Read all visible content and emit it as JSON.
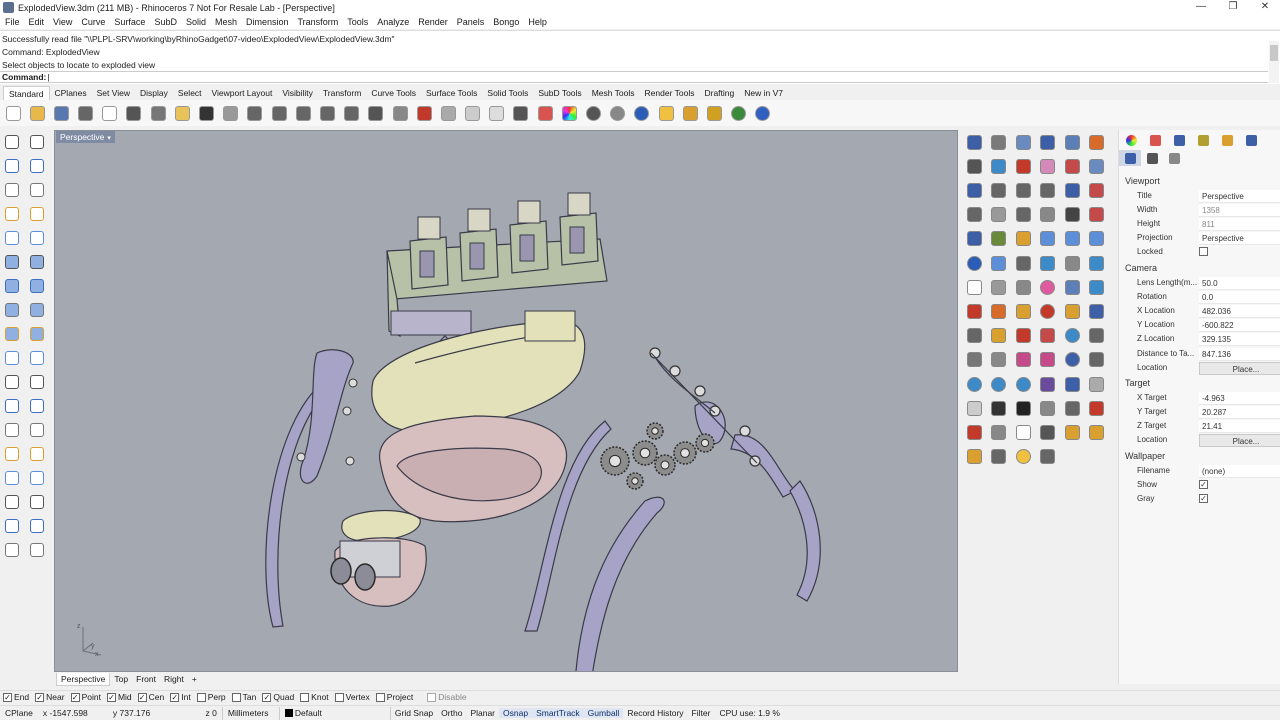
{
  "window": {
    "title": "ExplodedView.3dm (211 MB) - Rhinoceros 7 Not For Resale Lab - [Perspective]",
    "controls": [
      "—",
      "❐",
      "✕"
    ]
  },
  "menu": [
    "File",
    "Edit",
    "View",
    "Curve",
    "Surface",
    "SubD",
    "Solid",
    "Mesh",
    "Dimension",
    "Transform",
    "Tools",
    "Analyze",
    "Render",
    "Panels",
    "Bongo",
    "Help"
  ],
  "command": {
    "history": [
      "Successfully read file \"\\\\PLPL-SRV\\working\\byRhinoGadget\\07-video\\ExplodedView\\ExplodedView.3dm\"",
      "Command: ExplodedView",
      "Select objects to locate to exploded view"
    ],
    "prompt": "Command:"
  },
  "toolbar_tabs": [
    "Standard",
    "CPlanes",
    "Set View",
    "Display",
    "Select",
    "Viewport Layout",
    "Visibility",
    "Transform",
    "Curve Tools",
    "Surface Tools",
    "Solid Tools",
    "SubD Tools",
    "Mesh Tools",
    "Render Tools",
    "Drafting",
    "New in V7"
  ],
  "toolbar_icons": [
    "new-file-icon",
    "open-file-icon",
    "save-icon",
    "print-icon",
    "import-icon",
    "cut-icon",
    "copy-icon",
    "paste-icon",
    "undo-icon",
    "pan-hand-icon",
    "rotate-view-icon",
    "zoom-icon",
    "zoom-window-icon",
    "zoom-extents-icon",
    "zoom-selected-icon",
    "undo-view-icon",
    "grid-icon",
    "car-icon",
    "named-view-icon",
    "cplane-icon",
    "light-bulb-icon",
    "lock-icon",
    "materials-icon",
    "color-wheel-icon",
    "render-sphere-icon",
    "render-sphere-gray-icon",
    "blue-sphere-icon",
    "filter-icon",
    "gear-icon",
    "gears-icon",
    "render-globe-icon",
    "help-icon"
  ],
  "toolbar_icon_colors": [
    "#ffffff",
    "#e8b84a",
    "#5a78b0",
    "#666666",
    "#ffffff",
    "#555555",
    "#777777",
    "#e8c35a",
    "#333333",
    "#999999",
    "#666666",
    "#666666",
    "#666666",
    "#666666",
    "#666666",
    "#555555",
    "#888888",
    "#c0392b",
    "#aaaaaa",
    "#cccccc",
    "#dddddd",
    "#555555",
    "#d9534f",
    "#e05aa0",
    "#555555",
    "#888888",
    "#2b5cb8",
    "#f0c040",
    "#d9a030",
    "#d0a020",
    "#3a8a3a",
    "#3060c0"
  ],
  "viewport": {
    "label": "Perspective",
    "axis": {
      "z": "z",
      "x": "x",
      "y": "y"
    },
    "colors": {
      "bg": "#a4a8b1",
      "purple": "#a7a3c7",
      "green": "#b6c1a8",
      "cream": "#e3e1b9",
      "pink": "#d7bfc0",
      "gear": "#8c8c8c"
    }
  },
  "view_tabs": [
    "Perspective",
    "Top",
    "Front",
    "Right",
    "+"
  ],
  "left_icons": [
    "select-arrow-icon",
    "point-icon",
    "polyline-icon",
    "curve-icon",
    "circle-icon",
    "ellipse-icon",
    "arc-icon",
    "rectangle-icon",
    "polygon-icon",
    "fillet-curve-icon",
    "surface-icon",
    "surface-edit-icon",
    "box-icon",
    "sphere-icon",
    "cylinder-icon",
    "solid-edit-icon",
    "boolean-icon",
    "explode-icon",
    "transform-icon",
    "mirror-icon",
    "group-icon",
    "cluster-icon",
    "split-icon",
    "trim-icon",
    "text-icon",
    "dimension-icon",
    "array-icon",
    "align-icon",
    "mesh-icon",
    "mesh-edit-icon",
    "grid-dots-icon",
    "curve-edit-icon",
    "checkmark-icon",
    "analyze-icon",
    "render-icon",
    "layer-icon"
  ],
  "right_icons": [
    "network-icon",
    "flow-icon",
    "gear-blue-icon",
    "pipe-icon",
    "box-blue-icon",
    "cube-orange-icon",
    "camera-icon",
    "flow-blue-icon",
    "scissors-icon",
    "rhd-icon",
    "frame-icon",
    "box-frame-icon",
    "extrude-icon",
    "sweep-icon",
    "curve-icon",
    "curve-end-icon",
    "loft-icon",
    "arc-red-icon",
    "split-icon",
    "cloud-icon",
    "join-icon",
    "capsule-icon",
    "cube-dark-icon",
    "link-icon",
    "sweep-blue-icon",
    "palm-icon",
    "camera-yellow-icon",
    "cap-blue-icon",
    "cap-blue2-icon",
    "cap-blue3-icon",
    "sphere-blue-icon",
    "blend-icon",
    "chain-icon",
    "flow2-icon",
    "text-123-icon",
    "wave-icon",
    "cube-white-icon",
    "cube-gray-icon",
    "cube-gear-icon",
    "color-ball-icon",
    "box-blue2-icon",
    "cube-front-icon",
    "cube-red-icon",
    "arrows-orange-icon",
    "arrow-target-icon",
    "sphere-color-icon",
    "gear-orange-icon",
    "cube-blue-icon",
    "move-icon",
    "flower-icon",
    "chain-red-icon",
    "grid-red-icon",
    "sphere-grid-icon",
    "transform-icon",
    "pencil-icon",
    "deg-icon",
    "arrow-pink-icon",
    "grid-pink-icon",
    "sphere-half-icon",
    "array-icon",
    "balls-icon",
    "balls2-icon",
    "balls3-icon",
    "grid-purple-icon",
    "cube-blue3-icon",
    "cube-outline-icon",
    "cube-white2-icon",
    "z-icon",
    "z-dark-icon",
    "box-stack-icon",
    "bar-icon",
    "star-icon",
    "target-icon",
    "num-icon",
    "doc-icon",
    "umbrella-icon",
    "pages-icon",
    "folder-icon",
    "file-icon",
    "dot-icon",
    "question-icon",
    "check-line-icon"
  ],
  "right_icon_colors": [
    "#3c5fa8",
    "#7a7a7a",
    "#6a8bc0",
    "#3c5fa8",
    "#5d7fb8",
    "#d96b2a",
    "#555555",
    "#3c8ac8",
    "#c43a2a",
    "#d48ab8",
    "#c44a4a",
    "#6a8bc0",
    "#3c5fa8",
    "#666666",
    "#666666",
    "#666666",
    "#3c5fa8",
    "#c44a4a",
    "#666666",
    "#999999",
    "#666666",
    "#888888",
    "#444444",
    "#c44a4a",
    "#3c5fa8",
    "#6a8a3a",
    "#d9a030",
    "#5d8fd8",
    "#5d8fd8",
    "#5d8fd8",
    "#2b5cb8",
    "#5d8fd8",
    "#666666",
    "#3c8ac8",
    "#888888",
    "#3c8ac8",
    "#ffffff",
    "#999999",
    "#888888",
    "#e05aa0",
    "#5d7fb8",
    "#3c8ac8",
    "#c43a2a",
    "#d96b2a",
    "#d9a030",
    "#c43a2a",
    "#d9a030",
    "#3c5fa8",
    "#666666",
    "#d9a030",
    "#c43a2a",
    "#c44a4a",
    "#3c8ac8",
    "#666666",
    "#777777",
    "#888888",
    "#c44a8a",
    "#c44a8a",
    "#3c5fa8",
    "#666666",
    "#3c8ac8",
    "#3c8ac8",
    "#3c8ac8",
    "#6a4a9a",
    "#3c5fa8",
    "#aaaaaa",
    "#cccccc",
    "#333333",
    "#222222",
    "#888888",
    "#666666",
    "#c43a2a",
    "#c43a2a",
    "#888888",
    "#ffffff",
    "#555555",
    "#d9a030",
    "#d9a030",
    "#d9a030",
    "#666666",
    "#f0c040",
    "#666666"
  ],
  "properties": {
    "tab_icons": [
      "color-ball-icon",
      "material-icon",
      "render-cube-icon",
      "pen-icon",
      "folder-icon",
      "layers-icon"
    ],
    "tab_icon_colors": [
      "#c43a2a",
      "#d9534f",
      "#3c5fa8",
      "#b0a030",
      "#d9a030",
      "#3c5fa8"
    ],
    "subtab_icons": [
      "camera-icon",
      "sun-icon",
      "frame-icon"
    ],
    "subtab_icon_colors": [
      "#3c5fa8",
      "#555555",
      "#888888"
    ],
    "viewport_section": "Viewport",
    "viewport": [
      {
        "k": "Title",
        "v": "Perspective"
      },
      {
        "k": "Width",
        "v": "1358",
        "gray": true
      },
      {
        "k": "Height",
        "v": "811",
        "gray": true
      },
      {
        "k": "Projection",
        "v": "Perspective",
        "dd": true
      },
      {
        "k": "Locked",
        "cb": ""
      }
    ],
    "camera_section": "Camera",
    "camera": [
      {
        "k": "Lens Length(m...",
        "v": "50.0"
      },
      {
        "k": "Rotation",
        "v": "0.0"
      },
      {
        "k": "X Location",
        "v": "482.036"
      },
      {
        "k": "Y Location",
        "v": "-600.822"
      },
      {
        "k": "Z Location",
        "v": "329.135"
      },
      {
        "k": "Distance to Ta...",
        "v": "847.136"
      },
      {
        "k": "Location",
        "btn": "Place..."
      }
    ],
    "target_section": "Target",
    "target": [
      {
        "k": "X Target",
        "v": "-4.963"
      },
      {
        "k": "Y Target",
        "v": "20.287"
      },
      {
        "k": "Z Target",
        "v": "21.41"
      },
      {
        "k": "Location",
        "btn": "Place..."
      }
    ],
    "wallpaper_section": "Wallpaper",
    "wallpaper": [
      {
        "k": "Filename",
        "v": "(none)",
        "dd": true
      },
      {
        "k": "Show",
        "cb": "✓"
      },
      {
        "k": "Gray",
        "cb": "✓"
      }
    ]
  },
  "osnaps": [
    {
      "label": "End",
      "on": true
    },
    {
      "label": "Near",
      "on": true
    },
    {
      "label": "Point",
      "on": true
    },
    {
      "label": "Mid",
      "on": true
    },
    {
      "label": "Cen",
      "on": true
    },
    {
      "label": "Int",
      "on": true
    },
    {
      "label": "Perp",
      "on": false
    },
    {
      "label": "Tan",
      "on": false
    },
    {
      "label": "Quad",
      "on": true
    },
    {
      "label": "Knot",
      "on": false
    },
    {
      "label": "Vertex",
      "on": false
    },
    {
      "label": "Project",
      "on": false
    },
    {
      "label": "Disable",
      "on": false,
      "dim": true
    }
  ],
  "status": {
    "cplane": "CPlane",
    "x": "x -1547.598",
    "y": "y 737.176",
    "z": "z 0",
    "units": "Millimeters",
    "layer": "Default",
    "toggles": [
      {
        "label": "Grid Snap",
        "on": false
      },
      {
        "label": "Ortho",
        "on": false
      },
      {
        "label": "Planar",
        "on": false
      },
      {
        "label": "Osnap",
        "on": true
      },
      {
        "label": "SmartTrack",
        "on": true
      },
      {
        "label": "Gumball",
        "on": true
      },
      {
        "label": "Record History",
        "on": false
      },
      {
        "label": "Filter",
        "on": false
      }
    ],
    "cpu": "CPU use: 1.9 %"
  }
}
